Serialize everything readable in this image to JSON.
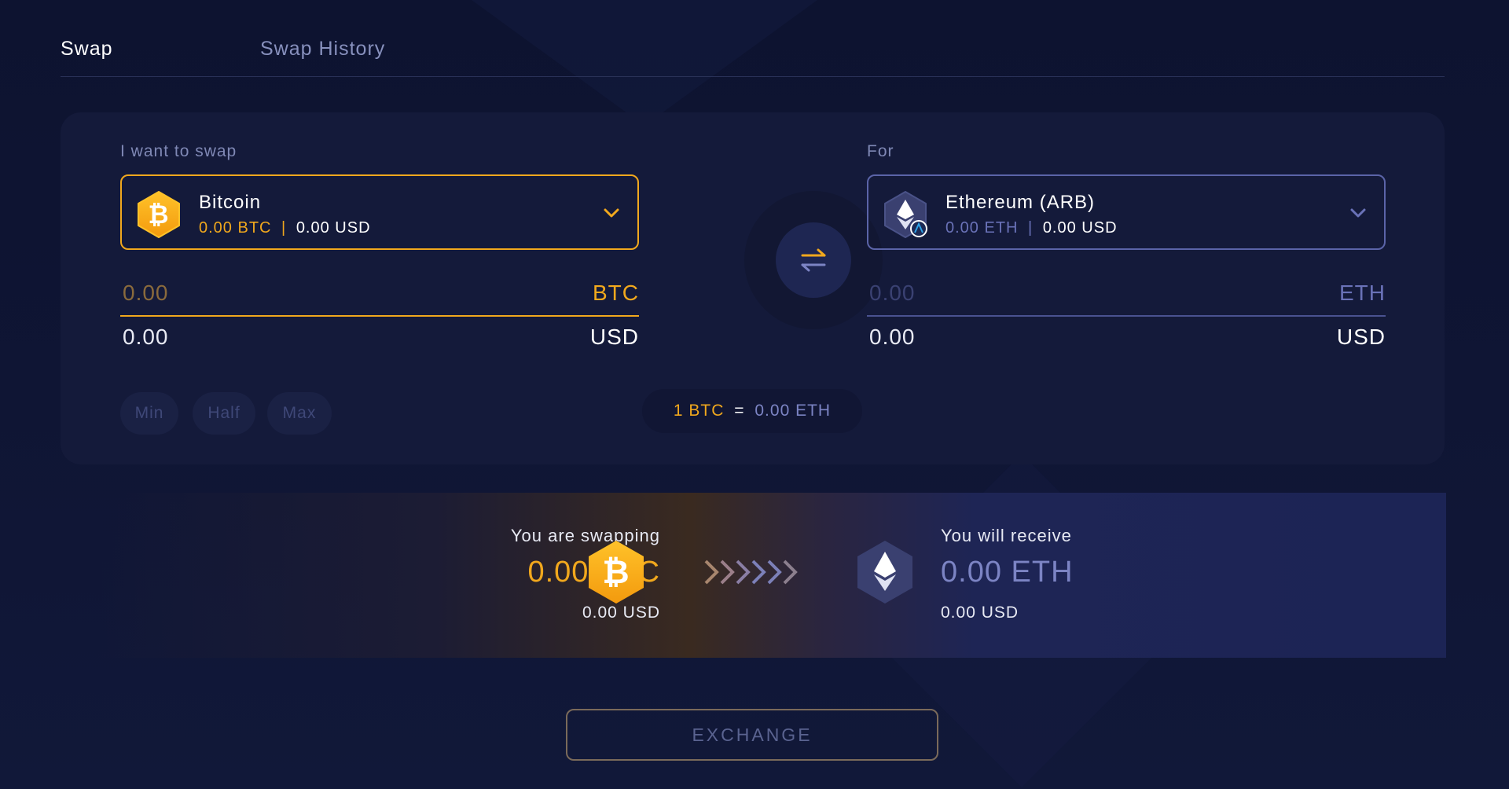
{
  "tabs": [
    {
      "label": "Swap",
      "active": true
    },
    {
      "label": "Swap History",
      "active": false
    }
  ],
  "from": {
    "label": "I want to swap",
    "coin_name": "Bitcoin",
    "balance_coin": "0.00 BTC",
    "balance_usd": "0.00 USD",
    "icon": "bitcoin-icon",
    "amount": "0.00",
    "amount_unit": "BTC",
    "usd_amount": "0.00",
    "usd_unit": "USD"
  },
  "to": {
    "label": "For",
    "coin_name": "Ethereum (ARB)",
    "balance_coin": "0.00 ETH",
    "balance_usd": "0.00 USD",
    "icon": "ethereum-icon",
    "amount": "0.00",
    "amount_unit": "ETH",
    "usd_amount": "0.00",
    "usd_unit": "USD"
  },
  "quick_amounts": [
    "Min",
    "Half",
    "Max"
  ],
  "rate": {
    "left": "1 BTC",
    "eq": "=",
    "right": "0.00 ETH"
  },
  "summary": {
    "swapping_label": "You are swapping",
    "swapping_amount": "0.00 BTC",
    "swapping_usd": "0.00 USD",
    "receive_label": "You will receive",
    "receive_amount": "0.00 ETH",
    "receive_usd": "0.00 USD"
  },
  "exchange_button": "EXCHANGE",
  "colors": {
    "btc_accent": "#f1a81d",
    "eth_accent": "#6a72b8",
    "background": "#0f1534",
    "card": "#141a3a"
  }
}
